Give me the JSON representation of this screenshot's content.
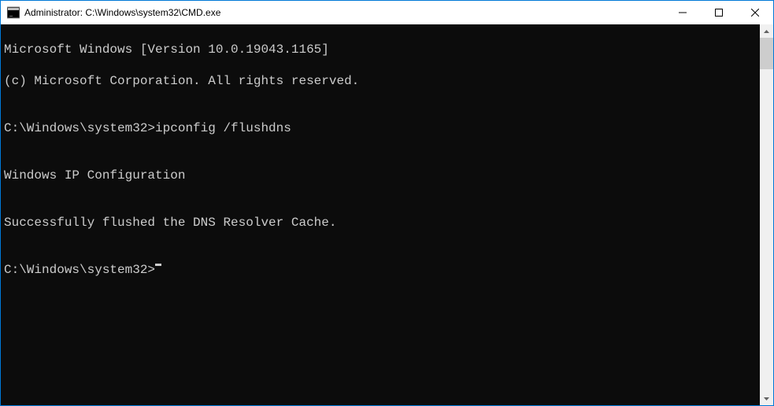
{
  "window": {
    "title": "Administrator: C:\\Windows\\system32\\CMD.exe"
  },
  "terminal": {
    "lines": [
      "Microsoft Windows [Version 10.0.19043.1165]",
      "(c) Microsoft Corporation. All rights reserved.",
      "",
      "C:\\Windows\\system32>ipconfig /flushdns",
      "",
      "Windows IP Configuration",
      "",
      "Successfully flushed the DNS Resolver Cache.",
      ""
    ],
    "prompt": "C:\\Windows\\system32>"
  }
}
